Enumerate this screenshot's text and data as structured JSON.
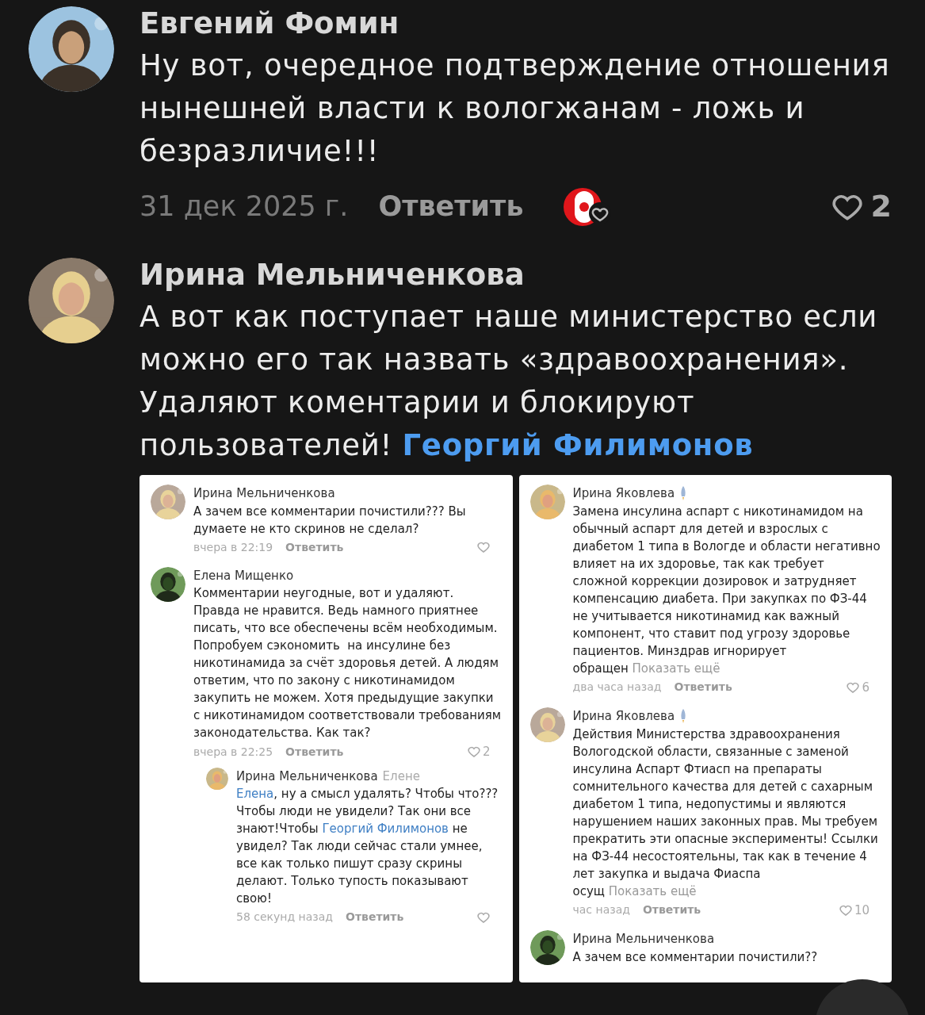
{
  "comments": [
    {
      "author": "Евгений Фомин",
      "text": [
        {
          "text": "Ну вот, очередное подтверждение отношения нынешней власти к вологжанам - ложь и безразличие!!!",
          "link": false
        }
      ],
      "date": "31 дек 2025 г.",
      "reply": "Ответить",
      "reaction": true,
      "likes": "2"
    },
    {
      "author": "Ирина Мельниченкова",
      "text": [
        {
          "text": "А вот как поступает наше министерство если можно его так назвать «здравоохранения». Удаляют коментарии и блокируют пользователей! ",
          "link": false
        },
        {
          "text": "Георгий Филимонов",
          "link": true
        }
      ],
      "screenshots": [
        {
          "comments": [
            {
              "author": "Ирина Мельниченкова",
              "nested": false,
              "text": [
                {
                  "text": "А зачем все комментарии почистили??? Вы думаете не кто скринов не сделал?",
                  "link": false
                }
              ],
              "time": "вчера в 22:19",
              "reply": "Ответить"
            },
            {
              "author": "Елена Мищенко",
              "nested": false,
              "text": [
                {
                  "text": "Комментарии неугодные, вот и удаляют. Правда не нравится. Ведь намного приятнее писать, что все обеспечены всём необходимым. Попробуем сэкономить  на инсулине без никотинамида за счёт здоровья детей. А людям ответим, что по закону с никотинамидом закупить не можем. Хотя предыдущие закупки с никотинамидом соответствовали требованиям законодательства. Как так?",
                  "link": false
                }
              ],
              "time": "вчера в 22:25",
              "reply": "Ответить",
              "likes": "2"
            },
            {
              "author": "Ирина Мельниченкова",
              "addressee": "Елене",
              "nested": true,
              "text": [
                {
                  "text": "Елена",
                  "link": true
                },
                {
                  "text": ", ну а смысл удалять? Чтобы что??? Чтобы люди не увидели? Так они все знают!Чтобы ",
                  "link": false
                },
                {
                  "text": "Георгий Филимонов",
                  "link": true
                },
                {
                  "text": " не увидел? Так люди сейчас стали умнее, все как только пишут сразу скрины делают. Только тупость показывают свою!",
                  "link": false
                }
              ],
              "time": "58 секунд назад",
              "reply": "Ответить"
            }
          ]
        },
        {
          "comments": [
            {
              "author": "Ирина Яковлева",
              "badge": true,
              "nested": false,
              "text": [
                {
                  "text": "Замена инсулина аспарт с никотинамидом на обычный аспарт для детей и взрослых с диабетом 1 типа в Вологде и области негативно влияет на их здоровье, так как требует сложной коррекции дозировок и затрудняет компенсацию диабета. При закупках по ФЗ-44 не учитывается никотинамид как важный компонент, что ставит под угрозу здоровье пациентов. Минздрав игнорирует обращен",
                  "link": false
                }
              ],
              "more": "Показать ещё",
              "time": "два часа назад",
              "reply": "Ответить",
              "likes": "6"
            },
            {
              "author": "Ирина Яковлева",
              "badge": true,
              "nested": false,
              "text": [
                {
                  "text": "Действия Министерства здравоохранения Вологодской области, связанные с заменой инсулина Аспарт Фтиасп на препараты сомнительного качества для детей с сахарным диабетом 1 типа, недопустимы и являются нарушением наших законных прав. Мы требуем прекратить эти опасные эксперименты! Ссылки на ФЗ-44 несостоятельны, так как в течение 4 лет закупка и выдача Фиаспа осущ",
                  "link": false
                }
              ],
              "more": "Показать ещё",
              "time": "час назад",
              "reply": "Ответить",
              "likes": "10"
            },
            {
              "author": "Ирина Мельниченкова",
              "badge": false,
              "nested": false,
              "text": [
                {
                  "text": "А зачем все комментарии почистили??",
                  "link": false
                }
              ]
            }
          ]
        }
      ]
    }
  ]
}
